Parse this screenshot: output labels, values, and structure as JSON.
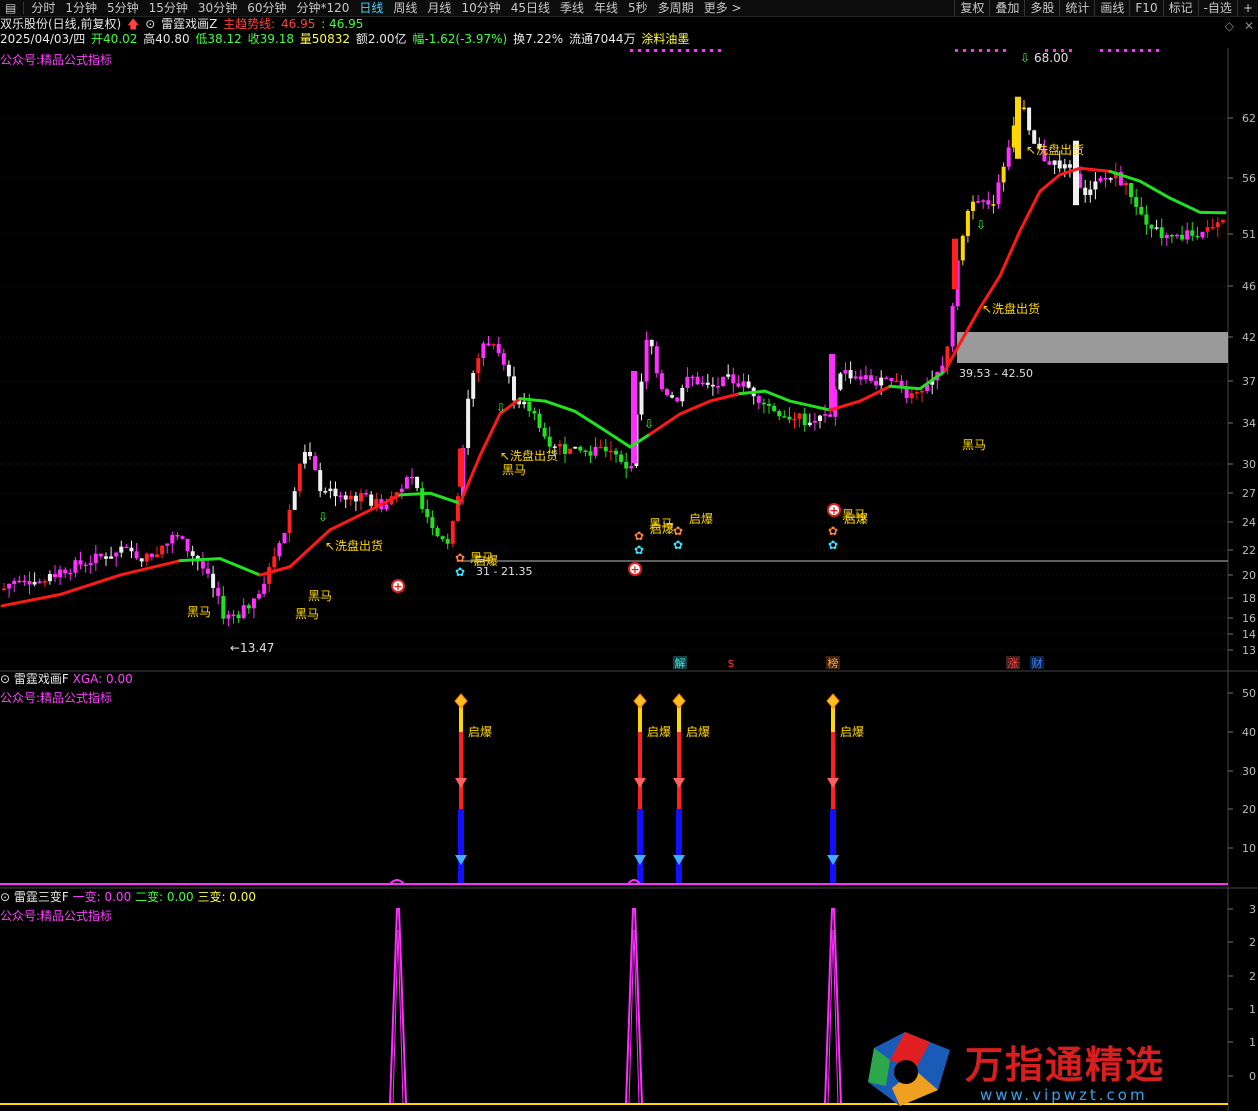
{
  "toolbar": {
    "items": [
      "分时",
      "1分钟",
      "5分钟",
      "15分钟",
      "30分钟",
      "60分钟",
      "分钟*120",
      "日线",
      "周线",
      "月线",
      "10分钟",
      "45日线",
      "季线",
      "年线",
      "5秒",
      "多周期",
      "更多 >"
    ],
    "active": "日线",
    "right_items": [
      "复权",
      "叠加",
      "多股",
      "统计",
      "画线",
      "F10",
      "标记",
      "-自选",
      "+"
    ]
  },
  "header": {
    "stock": "双乐股份(日线,前复权)",
    "indicator": "雷霆戏画Z",
    "trend_label": "主趋势线:",
    "trend_v1": "46.95",
    "trend_v2": ": 46.95",
    "date": "2025/04/03/四",
    "open": "开40.02",
    "high": "高40.80",
    "low": "低38.12",
    "close": "收39.18",
    "volume": "量50832",
    "amount": "额2.00亿",
    "change": "幅-1.62(-3.97%)",
    "turnover": "换7.22%",
    "float": "流通7044万",
    "sector": "涂料油墨",
    "watermark1": "公众号:精品公式指标"
  },
  "colors": {
    "bull": "#ff2020",
    "bear": "#20e020",
    "magenta": "#ff30ff",
    "yellow": "#ffd700",
    "white": "#f0f0f0",
    "darkgreen": "#18a030",
    "trend_up": "#ff1818",
    "trend_down": "#22e022"
  },
  "panel1": {
    "y_ticks": [
      "62",
      "56",
      "51",
      "46",
      "42",
      "37",
      "34",
      "30",
      "27",
      "24",
      "22",
      "20",
      "18",
      "16",
      "14",
      "13"
    ],
    "labels": {
      "peak": "68.00",
      "low": "13.47",
      "zone": "39.53 - 42.50",
      "zone2": "31 - 21.35",
      "wash": "洗盘出货",
      "horse": "黑马",
      "burst": "启爆"
    },
    "events": [
      "解",
      "$",
      "榜",
      "涨",
      "财"
    ]
  },
  "panel2": {
    "title": "雷霆戏画F",
    "xga": "XGA: 0.00",
    "watermark": "公众号:精品公式指标",
    "y_ticks": [
      "50",
      "40",
      "30",
      "20",
      "10"
    ],
    "burst": "启爆"
  },
  "panel3": {
    "title": "雷霆三变F",
    "v1": "一变: 0.00",
    "v2": "二变: 0.00",
    "v3": "三变: 0.00",
    "watermark": "公众号:精品公式指标",
    "y_ticks": [
      "3",
      "2",
      "2",
      "1",
      "1",
      "0"
    ]
  },
  "chart_data": {
    "type": "candlestick",
    "ylim": [
      12,
      70
    ],
    "peak": 68.0,
    "trough": 13.47,
    "zone": [
      39.53,
      42.5
    ]
  },
  "brand": {
    "name": "万指通精选",
    "url": "www.vipwzt.com"
  }
}
